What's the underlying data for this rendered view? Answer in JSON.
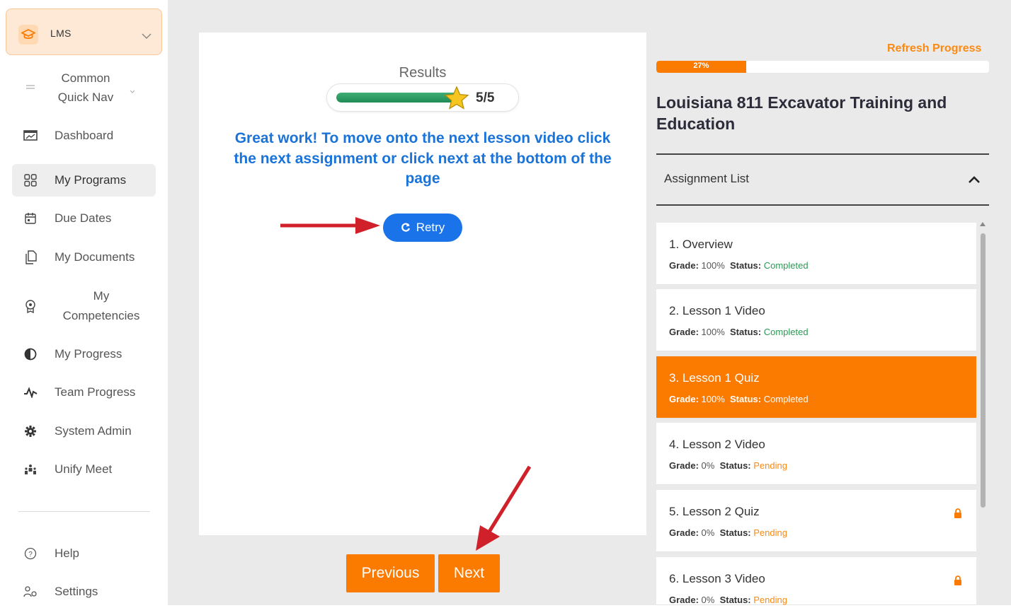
{
  "sidebar": {
    "app_switch": "LMS",
    "items": [
      {
        "label": "Common Quick Nav",
        "icon": "menu-icon"
      },
      {
        "label": "Dashboard",
        "icon": "dashboard-icon"
      },
      {
        "label": "My Programs",
        "icon": "grid-icon"
      },
      {
        "label": "Due Dates",
        "icon": "calendar-icon"
      },
      {
        "label": "My Documents",
        "icon": "documents-icon"
      },
      {
        "label": "My Competencies",
        "icon": "award-icon"
      },
      {
        "label": "My Progress",
        "icon": "progress-icon"
      },
      {
        "label": "Team Progress",
        "icon": "activity-icon"
      },
      {
        "label": "System Admin",
        "icon": "gear-icon"
      },
      {
        "label": "Unify Meet",
        "icon": "meet-icon"
      }
    ],
    "bottom": [
      {
        "label": "Help",
        "icon": "help-icon"
      },
      {
        "label": "Settings",
        "icon": "settings-icon"
      }
    ]
  },
  "quiz": {
    "results_title": "Results",
    "score": "5/5",
    "score_fraction": 1.0,
    "message": "Great work! To move onto the next lesson video click the next assignment or click next at the bottom of the page",
    "retry_label": "Retry"
  },
  "footer": {
    "previous_label": "Previous",
    "next_label": "Next"
  },
  "course": {
    "refresh_label": "Refresh Progress",
    "progress_label": "27%",
    "progress_value": 27,
    "title": "Louisiana 811 Excavator Training and Education",
    "assignment_list_label": "Assignment List"
  },
  "assignments": [
    {
      "title": "1. Overview",
      "grade_label": "Grade:",
      "grade": "100%",
      "status_label": "Status:",
      "status": "Completed",
      "locked": false
    },
    {
      "title": "2. Lesson 1 Video",
      "grade_label": "Grade:",
      "grade": "100%",
      "status_label": "Status:",
      "status": "Completed",
      "locked": false
    },
    {
      "title": "3. Lesson 1 Quiz",
      "grade_label": "Grade:",
      "grade": "100%",
      "status_label": "Status:",
      "status": "Completed",
      "locked": false
    },
    {
      "title": "4. Lesson 2 Video",
      "grade_label": "Grade:",
      "grade": "0%",
      "status_label": "Status:",
      "status": "Pending",
      "locked": false
    },
    {
      "title": "5. Lesson 2 Quiz",
      "grade_label": "Grade:",
      "grade": "0%",
      "status_label": "Status:",
      "status": "Pending",
      "locked": true
    },
    {
      "title": "6. Lesson 3 Video",
      "grade_label": "Grade:",
      "grade": "0%",
      "status_label": "Status:",
      "status": "Pending",
      "locked": true
    }
  ],
  "colors": {
    "accent": "#fb7a00",
    "link_blue": "#1a73d9",
    "completed": "#2b9a55",
    "pending": "#fb8a14",
    "annotation_arrow": "#d0202a"
  }
}
